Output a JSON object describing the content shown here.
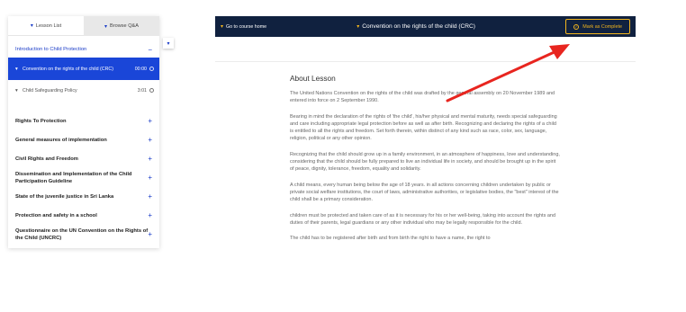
{
  "sidebar": {
    "tabs": [
      {
        "label": "Lesson List",
        "icon": "lesson-icon",
        "active": true
      },
      {
        "label": "Browse Q&A",
        "icon": "qa-icon",
        "active": false
      }
    ],
    "open_section": {
      "label": "Introduction to Child Protection",
      "toggle": "−"
    },
    "lessons": [
      {
        "title": "Convention on the rights of the child (CRC)",
        "duration": "00:00",
        "active": true
      },
      {
        "title": "Child Safeguarding Policy",
        "duration": "3:01",
        "active": false
      }
    ],
    "sections": [
      {
        "label": "Rights To Protection",
        "toggle": "+"
      },
      {
        "label": "General measures of implementation",
        "toggle": "+"
      },
      {
        "label": "Civil Rights and Freedom",
        "toggle": "+"
      },
      {
        "label": "Dissemination and Implementation of the Child Participation Guideline",
        "toggle": "+"
      },
      {
        "label": "State of the juvenile justice in Sri Lanka",
        "toggle": "+"
      },
      {
        "label": "Protection and safety in a school",
        "toggle": "+"
      },
      {
        "label": "Questionnaire on the UN Convention on the Rights of the Child (UNCRC)",
        "toggle": "+"
      }
    ]
  },
  "header": {
    "back_label": "Go to course home",
    "title": "Convention on the rights of the child (CRC)",
    "mark_complete_label": "Mark as Complete"
  },
  "content": {
    "heading": "About Lesson",
    "paragraphs": [
      "The United Nations Convention on the rights of the child was drafted by the general assembly on 20 November 1989 and entered into force on 2 September 1990.",
      "Bearing in mind the declaration of the rights of 'the child', his/her physical and mental maturity, needs special safeguarding and care including appropriate legal protection before as well as after birth. Recognizing and declaring the rights of a child is entitled to all the rights and freedom. Set forth therein, within distinct of any kind such as race, color, sex, language, religion, political or any other opinion.",
      "Recognizing that the child should grow up in a family environment, in an atmosphere of happiness, love and understanding, considering that the child should be fully prepared to live an individual life in society, and should be brought up in the spirit of peace, dignity, tolerance, freedom, equality and solidarity.",
      "A child means, every human being below the age of 18 years. in all actions concerning children undertaken by public or private social welfare institutions, the court of laws, administrative authorities, or legislative bodies, the \"best\" interest of the child shall be a primary consideration.",
      "children must be protected and taken care of as it is necessary for his or her well-being, taking into account the rights and duties of their parents, legal guardians or any other individual who may be legally responsible for the child.",
      "The child has to be registered after birth and from birth the right to have a name, the right to"
    ]
  },
  "colors": {
    "accent": "#1a46d8",
    "header_bg": "#10213f",
    "gold": "#f2b51e",
    "annotation_arrow": "#e8251f"
  }
}
